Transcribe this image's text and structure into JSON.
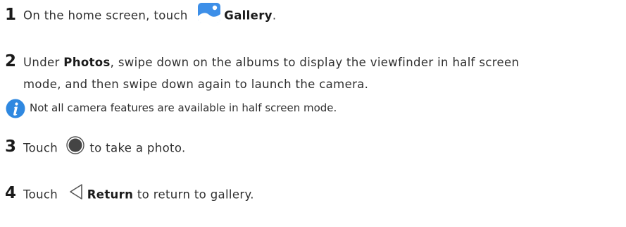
{
  "steps": [
    {
      "number": "1",
      "pre": "On the home screen, touch",
      "bold": "Gallery",
      "post": "."
    },
    {
      "number": "2",
      "pre": "Under ",
      "bold": "Photos",
      "post": ", swipe down on the albums to display the viewfinder in half screen",
      "line2": "mode, and then swipe down again to launch the camera."
    },
    {
      "number": "3",
      "pre": "Touch",
      "post": "to take a photo."
    },
    {
      "number": "4",
      "pre": "Touch",
      "bold": "Return",
      "post": "to return to gallery."
    }
  ],
  "note": {
    "text": "Not all camera features are available in half screen mode.",
    "icon": "info-icon"
  },
  "colors": {
    "gallery_icon": "#3d8fe8",
    "info_icon": "#2f88e0",
    "shutter": "#444444"
  }
}
